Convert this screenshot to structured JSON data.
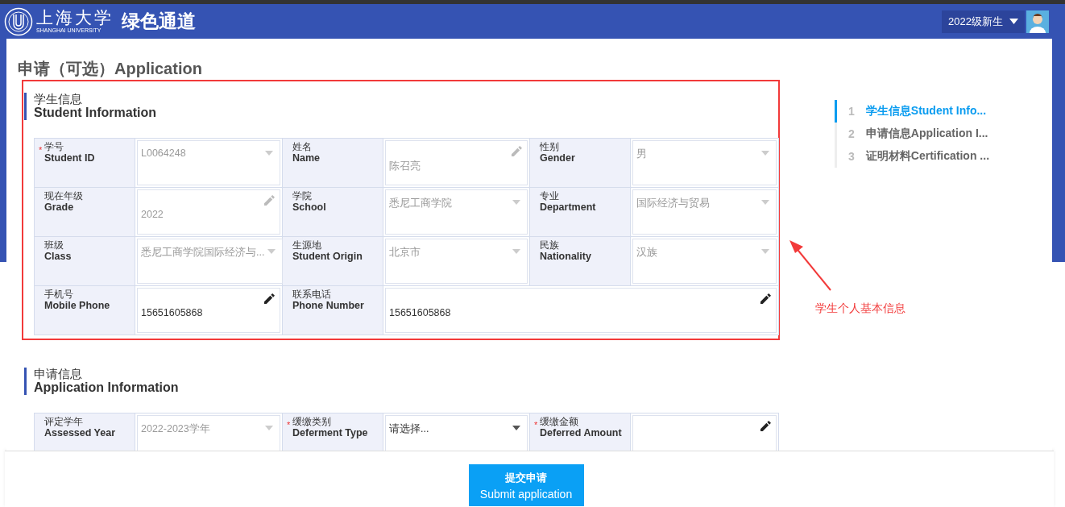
{
  "header": {
    "logo_cn": "上海大学",
    "logo_en": "SHANGHAI UNIVERSITY",
    "app_title": "绿色通道",
    "user_menu": "2022级新生"
  },
  "page_title": "申请（可选）Application",
  "sections": [
    {
      "title_cn": "学生信息",
      "title_en": "Student Information",
      "highlighted": true,
      "fields": [
        {
          "label_cn": "学号",
          "label_en": "Student ID",
          "kind": "select",
          "value": "L0064248",
          "disabled": true,
          "required_mark": "*"
        },
        {
          "label_cn": "姓名",
          "label_en": "Name",
          "kind": "text",
          "value": "陈召亮",
          "disabled": true
        },
        {
          "label_cn": "性别",
          "label_en": "Gender",
          "kind": "select",
          "value": "男",
          "disabled": true
        },
        {
          "label_cn": "现在年级",
          "label_en": "Grade",
          "kind": "text",
          "value": "2022",
          "disabled": true
        },
        {
          "label_cn": "学院",
          "label_en": "School",
          "kind": "select",
          "value": "悉尼工商学院",
          "disabled": true
        },
        {
          "label_cn": "专业",
          "label_en": "Department",
          "kind": "select",
          "value": "国际经济与贸易",
          "disabled": true
        },
        {
          "label_cn": "班级",
          "label_en": "Class",
          "kind": "select",
          "value": "悉尼工商学院国际经济与...",
          "disabled": true
        },
        {
          "label_cn": "生源地",
          "label_en": "Student Origin",
          "kind": "select",
          "value": "北京市",
          "disabled": true
        },
        {
          "label_cn": "民族",
          "label_en": "Nationality",
          "kind": "select",
          "value": "汉族",
          "disabled": true
        },
        {
          "label_cn": "手机号",
          "label_en": "Mobile Phone",
          "kind": "text",
          "value": "15651605868",
          "disabled": false
        },
        {
          "label_cn": "联系电话",
          "label_en": "Phone Number",
          "kind": "text",
          "value": "15651605868",
          "disabled": false,
          "wide": true
        }
      ]
    },
    {
      "title_cn": "申请信息",
      "title_en": "Application Information",
      "fields": [
        {
          "label_cn": "评定学年",
          "label_en": "Assessed Year",
          "kind": "select",
          "value": "2022-2023学年",
          "disabled": true
        },
        {
          "label_cn": "缓缴类别",
          "label_en": "Deferment Type",
          "kind": "select",
          "placeholder": "请选择...",
          "disabled": false,
          "required_mark": "*"
        },
        {
          "label_cn": "缓缴金额",
          "label_en": "Deferred Amount",
          "kind": "text",
          "disabled": false,
          "required_mark": "*"
        }
      ]
    }
  ],
  "annotation": {
    "text": "学生个人基本信息"
  },
  "nav": [
    {
      "number": "1",
      "label": "学生信息Student Info...",
      "selected": true
    },
    {
      "number": "2",
      "label": "申请信息Application I...",
      "selected": false
    },
    {
      "number": "3",
      "label": "证明材料Certification ...",
      "selected": false
    }
  ],
  "submit": {
    "label_cn": "提交申请",
    "label_en": "Submit application"
  }
}
